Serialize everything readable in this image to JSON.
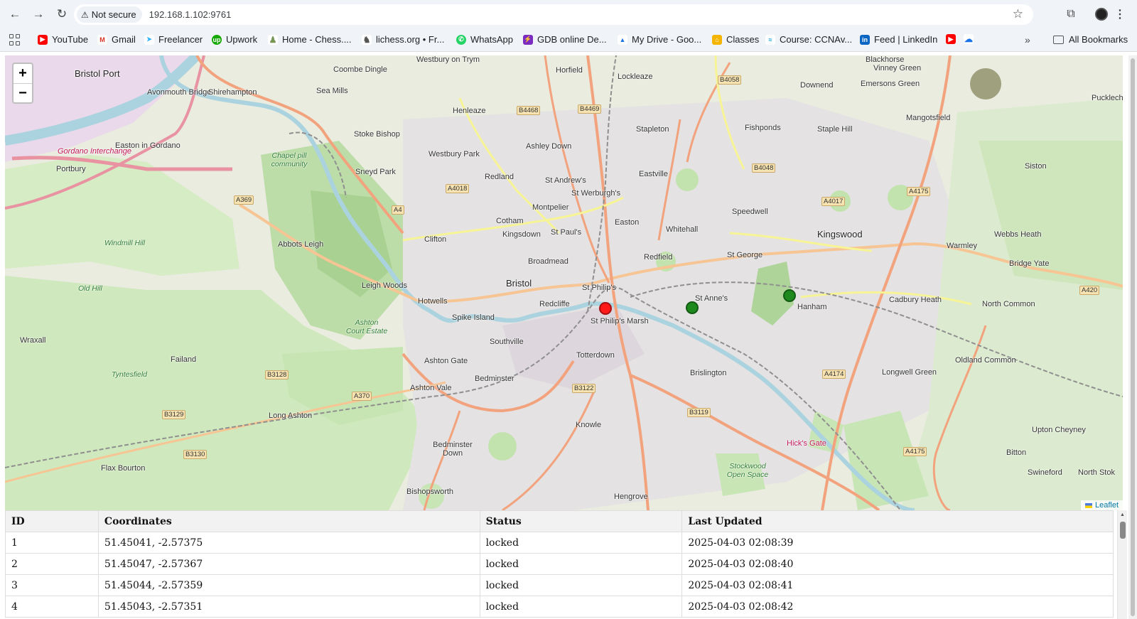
{
  "browser": {
    "security_label": "Not secure",
    "url": "192.168.1.102:9761",
    "bookmarks": [
      {
        "label": "YouTube",
        "color": "#ff0000",
        "glyph": "▶"
      },
      {
        "label": "Gmail",
        "color": "#d93025",
        "glyph": "M"
      },
      {
        "label": "Freelancer",
        "color": "#29b2fe",
        "glyph": "➤"
      },
      {
        "label": "Upwork",
        "color": "#14a800",
        "glyph": "up"
      },
      {
        "label": "Home - Chess....",
        "color": "#769656",
        "glyph": "♟"
      },
      {
        "label": "lichess.org • Fr...",
        "color": "#555555",
        "glyph": "♞"
      },
      {
        "label": "WhatsApp",
        "color": "#25d366",
        "glyph": "✆"
      },
      {
        "label": "GDB online De...",
        "color": "#7b2bbf",
        "glyph": "⚡"
      },
      {
        "label": "My Drive - Goo...",
        "color": "#1a73e8",
        "glyph": "▲"
      },
      {
        "label": "Classes",
        "color": "#f4b400",
        "glyph": "⌂"
      },
      {
        "label": "Course: CCNAv...",
        "color": "#049fd9",
        "glyph": "≈"
      },
      {
        "label": "Feed | LinkedIn",
        "color": "#0a66c2",
        "glyph": "in"
      }
    ],
    "all_bookmarks_label": "All Bookmarks"
  },
  "map": {
    "zoom_in": "+",
    "zoom_out": "−",
    "attribution": "Leaflet",
    "places": {
      "bristol_port": "Bristol Port",
      "avonmouth": "Avonmouth Bridge",
      "shirehampton": "Shirehampton",
      "sea_mills": "Sea Mills",
      "coombe_dingle": "Coombe Dingle",
      "westbury_trym": "Westbury on Trym",
      "horfield": "Horfield",
      "lockleaze": "Lockleaze",
      "blackhorse": "Blackhorse",
      "vinney_green": "Vinney Green",
      "emersons_green": "Emersons Green",
      "downend": "Downend",
      "pucklechurch": "Pucklechur",
      "henleaze": "Henleaze",
      "stoke_bishop": "Stoke Bishop",
      "westbury_park": "Westbury Park",
      "ashley_down": "Ashley Down",
      "stapleton": "Stapleton",
      "fishponds": "Fishponds",
      "staple_hill": "Staple Hill",
      "mangotsfield": "Mangotsfield",
      "easton_gordano": "Easton in Gordano",
      "gordano_interchange": "Gordano Interchange",
      "portbury": "Portbury",
      "chapel_pill": "Chapel pill community",
      "sneyd_park": "Sneyd Park",
      "redland": "Redland",
      "st_andrews": "St Andrew's",
      "st_werburghs": "St Werburgh's",
      "eastville": "Eastville",
      "speedwell": "Speedwell",
      "siston": "Siston",
      "montpelier": "Montpelier",
      "cotham": "Cotham",
      "kingsdown": "Kingsdown",
      "st_pauls": "St Paul's",
      "easton": "Easton",
      "whitehall": "Whitehall",
      "kingswood": "Kingswood",
      "webbs_heath": "Webbs Heath",
      "warmley": "Warmley",
      "abbots_leigh": "Abbots Leigh",
      "leigh_woods": "Leigh Woods",
      "clifton": "Clifton",
      "broadmead": "Broadmead",
      "redfield": "Redfield",
      "st_george": "St George",
      "bridge_yate": "Bridge Yate",
      "bristol": "Bristol",
      "hotwells": "Hotwells",
      "redcliffe": "Redcliffe",
      "st_philips": "St Philip's",
      "st_annes": "St Anne's",
      "hanham": "Hanham",
      "cadbury_heath": "Cadbury Heath",
      "north_common": "North Common",
      "spike_island": "Spike Island",
      "st_philips_marsh": "St Philip's Marsh",
      "ashton_court": "Ashton Court Estate",
      "wraxall": "Wraxall",
      "failand": "Failand",
      "southville": "Southville",
      "ashton_gate": "Ashton Gate",
      "totterdown": "Totterdown",
      "brislington": "Brislington",
      "longwell_green": "Longwell Green",
      "oldland_common": "Oldland Common",
      "tyntesfield": "Tyntesfield",
      "ashton_vale": "Ashton Vale",
      "bedminster": "Bedminster",
      "long_ashton": "Long Ashton",
      "knowle": "Knowle",
      "upton_cheyney": "Upton Cheyney",
      "bitton": "Bitton",
      "flax_bourton": "Flax Bourton",
      "bedminster_down": "Bedminster Down",
      "stockwood": "Stockwood Open Space",
      "swineford": "Swineford",
      "north_stoke": "North Stok",
      "bishopsworth": "Bishopsworth",
      "hengrove": "Hengrove",
      "old_hill": "Old Hill",
      "windmill_hill": "Windmill Hill",
      "hicks_gate": "Hick's Gate"
    },
    "roads": [
      "A369",
      "A4",
      "A4018",
      "B4468",
      "B4469",
      "B4058",
      "B4048",
      "A4017",
      "A4175",
      "A420",
      "B3128",
      "A370",
      "B3129",
      "B3130",
      "B3122",
      "B3119",
      "A4174",
      "A4175"
    ],
    "markers": [
      {
        "color": "#ff1a1a",
        "label": "red-marker"
      },
      {
        "color": "#1e8a1e",
        "label": "green-marker"
      },
      {
        "color": "#1e8a1e",
        "label": "green-marker"
      }
    ]
  },
  "table": {
    "headers": {
      "id": "ID",
      "coords": "Coordinates",
      "status": "Status",
      "updated": "Last Updated"
    },
    "rows": [
      {
        "id": "1",
        "coords": "51.45041, -2.57375",
        "status": "locked",
        "updated": "2025-04-03 02:08:39"
      },
      {
        "id": "2",
        "coords": "51.45047, -2.57367",
        "status": "locked",
        "updated": "2025-04-03 02:08:40"
      },
      {
        "id": "3",
        "coords": "51.45044, -2.57359",
        "status": "locked",
        "updated": "2025-04-03 02:08:41"
      },
      {
        "id": "4",
        "coords": "51.45043, -2.57351",
        "status": "locked",
        "updated": "2025-04-03 02:08:42"
      }
    ]
  }
}
